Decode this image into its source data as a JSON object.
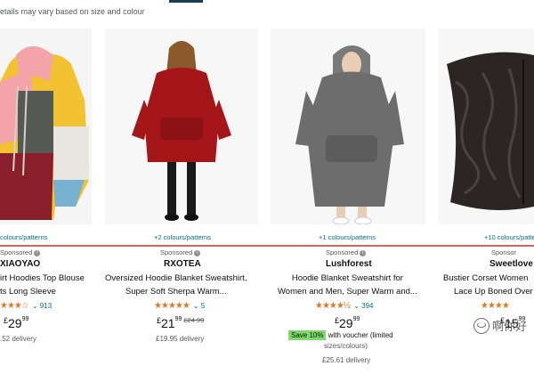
{
  "header": {
    "note": "etails may vary based on size and colour"
  },
  "products": [
    {
      "colours": "colours/patterns",
      "sponsored": "Sponsored",
      "brand": "XIAOYAO",
      "title_line1": "irt Hoodies Top Blouse",
      "title_line2": "ts Long Sleeve",
      "stars": "★★★☆",
      "rating_count": "913",
      "price_currency": "£",
      "price_main": "29",
      "price_cents": "99",
      "delivery": ".52 delivery"
    },
    {
      "colours": "+2 colours/patterns",
      "sponsored": "Sponsored",
      "brand": "RXOTEA",
      "title_line1": "Oversized Hoodie Blanket Sweatshirt,",
      "title_line2": "Super Soft Sherpa Warm...",
      "stars": "★★★★★",
      "rating_count": "5",
      "price_currency": "£",
      "price_main": "21",
      "price_cents": "99",
      "price_was": "£24.99",
      "delivery": "£19.95 delivery"
    },
    {
      "colours": "+1 colours/patterns",
      "sponsored": "Sponsored",
      "brand": "Lushforest",
      "title_line1": "Hoodie Blanket Sweatshirt for",
      "title_line2": "Women and Men, Super Warm and...",
      "stars": "★★★★½",
      "rating_count": "394",
      "price_currency": "£",
      "price_main": "29",
      "price_cents": "99",
      "save_badge": "Save 10%",
      "save_text": "with voucher (limited",
      "save_sub": "sizes/colours)",
      "delivery": "£25.61 delivery"
    },
    {
      "colours": "+10 colours/patte",
      "sponsored": "Sponsor",
      "brand": "Sweetlove",
      "title_line1": "Bustier Corset Women",
      "title_line2": "Lace Up Boned Over",
      "stars": "★★★★",
      "rating_count": "",
      "price_currency": "£",
      "price_main": "15",
      "price_cents": "99",
      "delivery": ""
    }
  ],
  "watermark": {
    "text": "啊你好"
  }
}
